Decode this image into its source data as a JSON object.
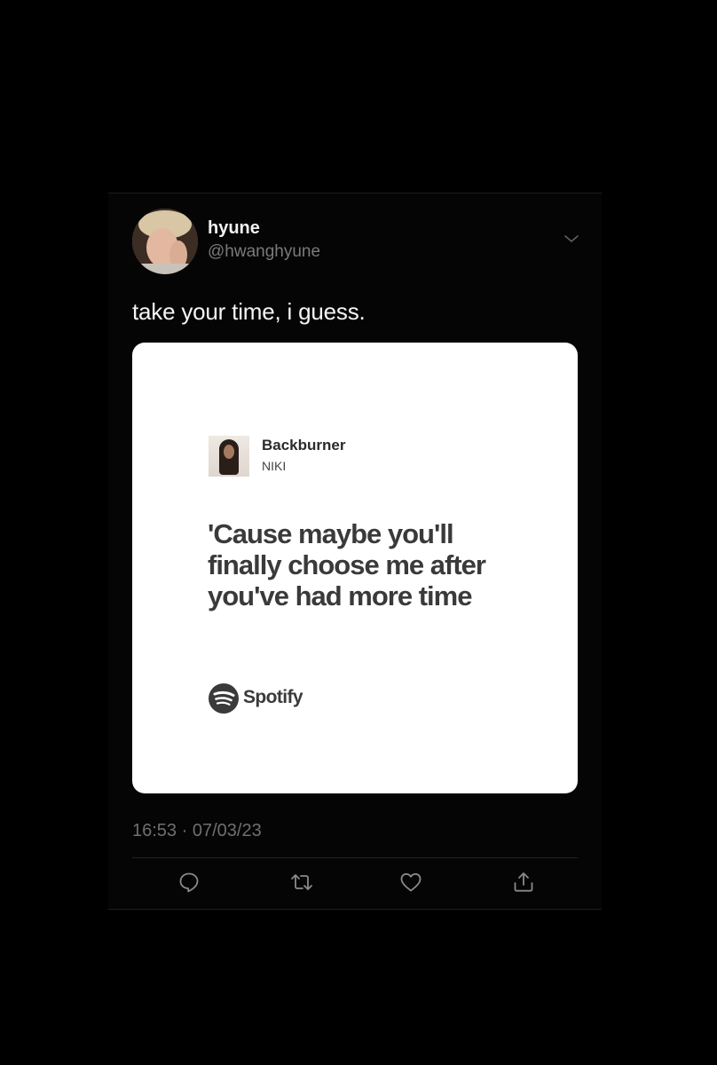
{
  "user": {
    "display_name": "hyune",
    "handle": "@hwanghyune"
  },
  "tweet": {
    "text": "take your time, i guess.",
    "time": "16:53",
    "separator": "·",
    "date": "07/03/23"
  },
  "card": {
    "song_title": "Backburner",
    "artist": "NIKI",
    "lyrics": "'Cause maybe you'll finally choose me after you've had more time",
    "brand": "Spotify"
  },
  "icons": {
    "menu": "chevron-down-icon",
    "reply": "reply-icon",
    "retweet": "retweet-icon",
    "like": "heart-icon",
    "share": "share-icon"
  },
  "colors": {
    "background": "#000000",
    "text_primary": "#f5f5f5",
    "text_secondary": "#7a7a7a",
    "card_bg": "#ffffff",
    "card_text": "#3a3a3a",
    "icon": "#8a8a8a"
  }
}
